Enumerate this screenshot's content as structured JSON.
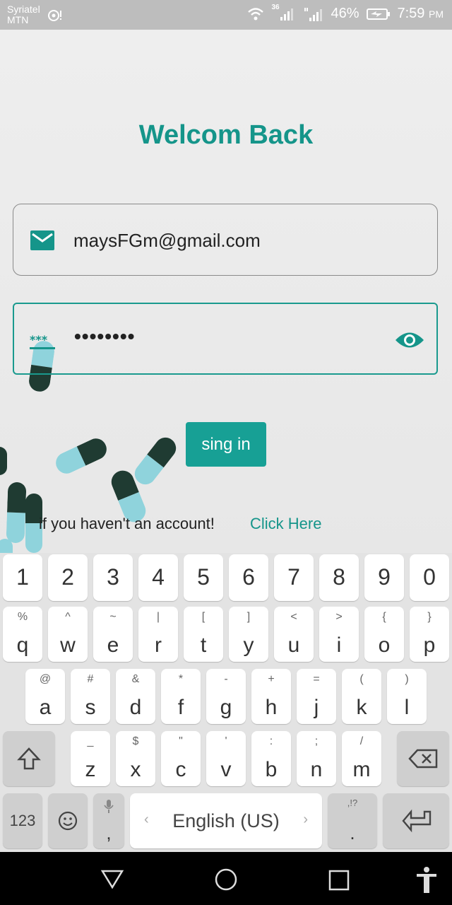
{
  "status": {
    "carrier_line1": "Syriatel",
    "carrier_line2": "MTN",
    "network": "36",
    "battery": "46%",
    "time": "7:59",
    "ampm": "PM"
  },
  "login": {
    "title": "Welcom Back",
    "email": "maysFGm@gmail.com",
    "password_mask": "••••••••",
    "signin_label": "sing in",
    "no_account": "if you haven't an account!",
    "click_here": "Click Here",
    "accent": "#15958a"
  },
  "keyboard": {
    "numbers": [
      "1",
      "2",
      "3",
      "4",
      "5",
      "6",
      "7",
      "8",
      "9",
      "0"
    ],
    "row1": [
      {
        "k": "q",
        "s": "%"
      },
      {
        "k": "w",
        "s": "^"
      },
      {
        "k": "e",
        "s": "~"
      },
      {
        "k": "r",
        "s": "|"
      },
      {
        "k": "t",
        "s": "["
      },
      {
        "k": "y",
        "s": "]"
      },
      {
        "k": "u",
        "s": "<"
      },
      {
        "k": "i",
        "s": ">"
      },
      {
        "k": "o",
        "s": "{"
      },
      {
        "k": "p",
        "s": "}"
      }
    ],
    "row2": [
      {
        "k": "a",
        "s": "@"
      },
      {
        "k": "s",
        "s": "#"
      },
      {
        "k": "d",
        "s": "&"
      },
      {
        "k": "f",
        "s": "*"
      },
      {
        "k": "g",
        "s": "-"
      },
      {
        "k": "h",
        "s": "+"
      },
      {
        "k": "j",
        "s": "="
      },
      {
        "k": "k",
        "s": "("
      },
      {
        "k": "l",
        "s": ")"
      }
    ],
    "row3": [
      {
        "k": "z",
        "s": "_"
      },
      {
        "k": "x",
        "s": "$"
      },
      {
        "k": "c",
        "s": "\""
      },
      {
        "k": "v",
        "s": "'"
      },
      {
        "k": "b",
        "s": ":"
      },
      {
        "k": "n",
        "s": ";"
      },
      {
        "k": "m",
        "s": "/"
      }
    ],
    "mode_key": "123",
    "comma": ",",
    "space_label": "English (US)",
    "period": ".",
    "period_hint": ",!?"
  }
}
